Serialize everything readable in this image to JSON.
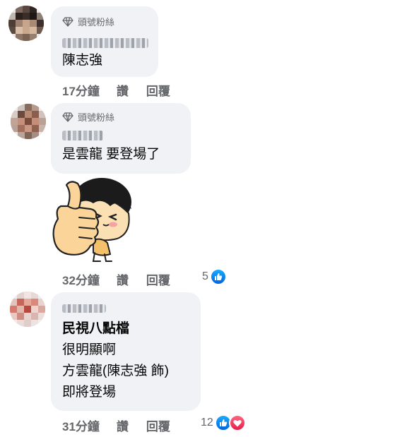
{
  "comments": [
    {
      "badge": "頭號粉絲",
      "name": "",
      "text_lines": [
        "陳志強"
      ],
      "time": "17分鐘",
      "like_label": "讚",
      "reply_label": "回覆",
      "reaction_count": ""
    },
    {
      "badge": "頭號粉絲",
      "name": "",
      "text_lines": [
        "是雲龍 要登場了"
      ],
      "time": "32分鐘",
      "like_label": "讚",
      "reply_label": "回覆",
      "reaction_count": "5",
      "reactions": [
        "like-icon"
      ]
    },
    {
      "badge": "",
      "name": "",
      "text_lines": [
        "民視八點檔",
        "很明顯啊",
        "方雲龍(陳志強 飾)",
        "即將登場"
      ],
      "time": "31分鐘",
      "like_label": "讚",
      "reply_label": "回覆",
      "reaction_count": "12",
      "reactions": [
        "like-icon",
        "love-icon"
      ]
    }
  ],
  "colors": {
    "bubble": "#f0f2f5",
    "meta_text": "#65676b",
    "like_blue": "#1877f2",
    "love_red": "#f33e58"
  }
}
